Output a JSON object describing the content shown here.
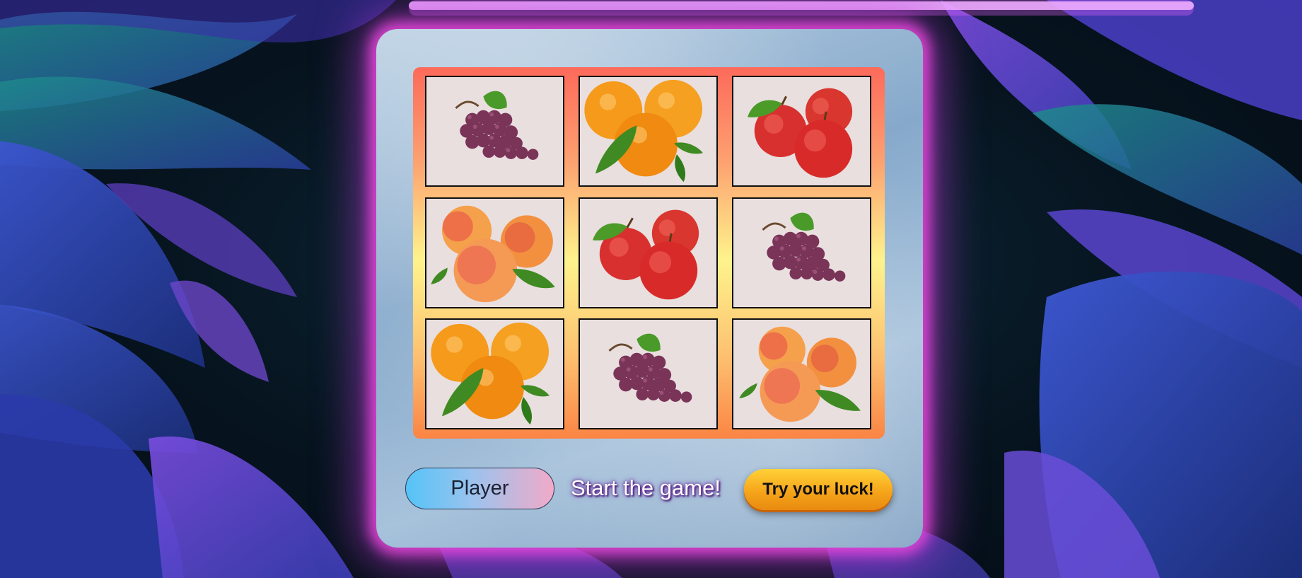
{
  "board": {
    "cells": [
      {
        "fruit": "grapes"
      },
      {
        "fruit": "oranges"
      },
      {
        "fruit": "apples"
      },
      {
        "fruit": "peaches"
      },
      {
        "fruit": "apples"
      },
      {
        "fruit": "grapes"
      },
      {
        "fruit": "oranges"
      },
      {
        "fruit": "grapes"
      },
      {
        "fruit": "peaches"
      }
    ]
  },
  "controls": {
    "player_label": "Player",
    "status": "Start the game!",
    "spin_label": "Try your luck!"
  },
  "colors": {
    "frame_glow": "#ec48dc",
    "board_top": "#fd6a5a",
    "board_mid": "#fef38c",
    "board_bottom": "#fb8444",
    "button": "#f6a51a"
  }
}
